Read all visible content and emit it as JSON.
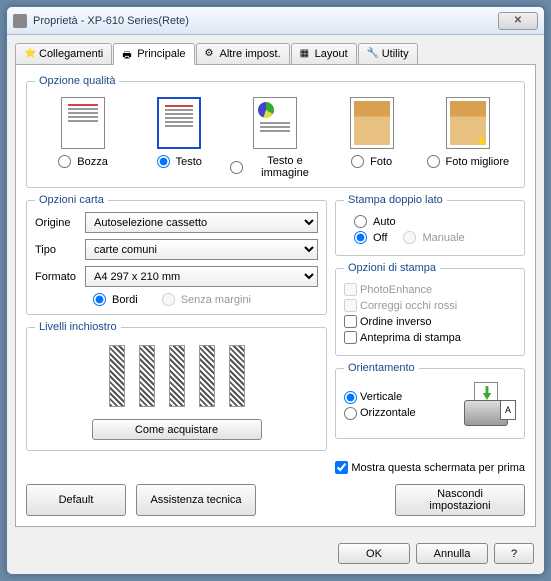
{
  "window": {
    "title": "Proprietà - XP-610 Series(Rete)"
  },
  "tabs": {
    "links": "Collegamenti",
    "main": "Principale",
    "other": "Altre impost.",
    "layout": "Layout",
    "utility": "Utility"
  },
  "quality": {
    "legend": "Opzione qualità",
    "draft": "Bozza",
    "text": "Testo",
    "textimage": "Testo e immagine",
    "photo": "Foto",
    "photobest": "Foto migliore"
  },
  "paper": {
    "legend": "Opzioni carta",
    "source_label": "Origine",
    "source_value": "Autoselezione cassetto",
    "type_label": "Tipo",
    "type_value": "carte comuni",
    "size_label": "Formato",
    "size_value": "A4 297 x 210 mm",
    "borders": "Bordi",
    "borderless": "Senza margini"
  },
  "duplex": {
    "legend": "Stampa doppio lato",
    "auto": "Auto",
    "off": "Off",
    "manual": "Manuale"
  },
  "printopts": {
    "legend": "Opzioni di stampa",
    "photoenhance": "PhotoEnhance",
    "redeye": "Correggi occhi rossi",
    "reverse": "Ordine inverso",
    "preview": "Anteprima di stampa"
  },
  "ink": {
    "legend": "Livelli inchiostro",
    "buy": "Come acquistare"
  },
  "orientation": {
    "legend": "Orientamento",
    "portrait": "Verticale",
    "landscape": "Orizzontale"
  },
  "showfirst": "Mostra questa schermata per prima",
  "buttons": {
    "default": "Default",
    "support": "Assistenza tecnica",
    "hide": "Nascondi impostazioni",
    "ok": "OK",
    "cancel": "Annulla",
    "help": "?"
  }
}
